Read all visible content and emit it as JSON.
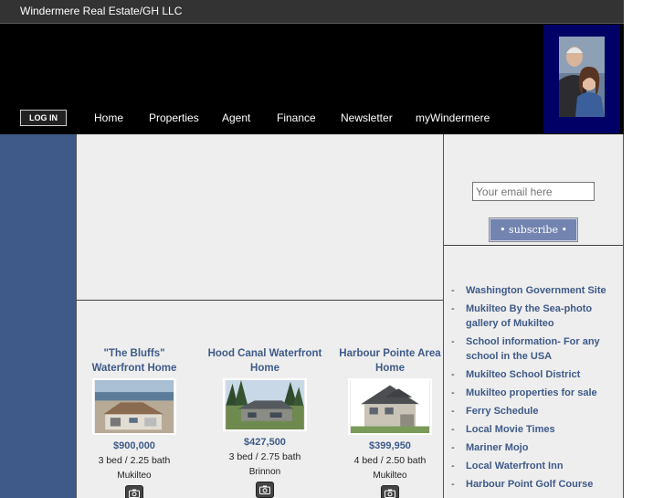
{
  "site": {
    "name": "Windermere Real Estate/GH LLC"
  },
  "header": {
    "login_label": "LOG IN",
    "nav": [
      "Home",
      "Properties",
      "Agent",
      "Finance",
      "Newsletter",
      "myWindermere"
    ]
  },
  "properties": [
    {
      "title": "\"The Bluffs\" Waterfront Home",
      "price": "$900,000",
      "rooms": "3 bed / 2.25 bath",
      "city": "Mukilteo"
    },
    {
      "title": "Hood Canal Waterfront Home",
      "price": "$427,500",
      "rooms": "3 bed / 2.75 bath",
      "city": "Brinnon"
    },
    {
      "title": "Harbour Pointe Area Home",
      "price": "$399,950",
      "rooms": "4 bed / 2.50 bath",
      "city": "Mukilteo"
    }
  ],
  "newsletter": {
    "email_placeholder": "Your email here",
    "subscribe_label": "• subscribe •"
  },
  "links": [
    "Washington Government Site",
    "Mukilteo By the Sea-photo gallery of Mukilteo",
    "School information- For any school in the USA",
    "Mukilteo School District",
    "Mukilteo properties for sale",
    "Ferry Schedule",
    "Local Movie Times",
    "Mariner Mojo",
    "Local Waterfront Inn",
    "Harbour Point Golf Course"
  ],
  "colors": {
    "accent": "#3f5a88",
    "header_bg": "#000000",
    "topbar_bg": "#333333",
    "photo_bg": "#000066",
    "subscribe_bg": "#7384b0"
  },
  "icons": {
    "camera": "camera-icon"
  }
}
